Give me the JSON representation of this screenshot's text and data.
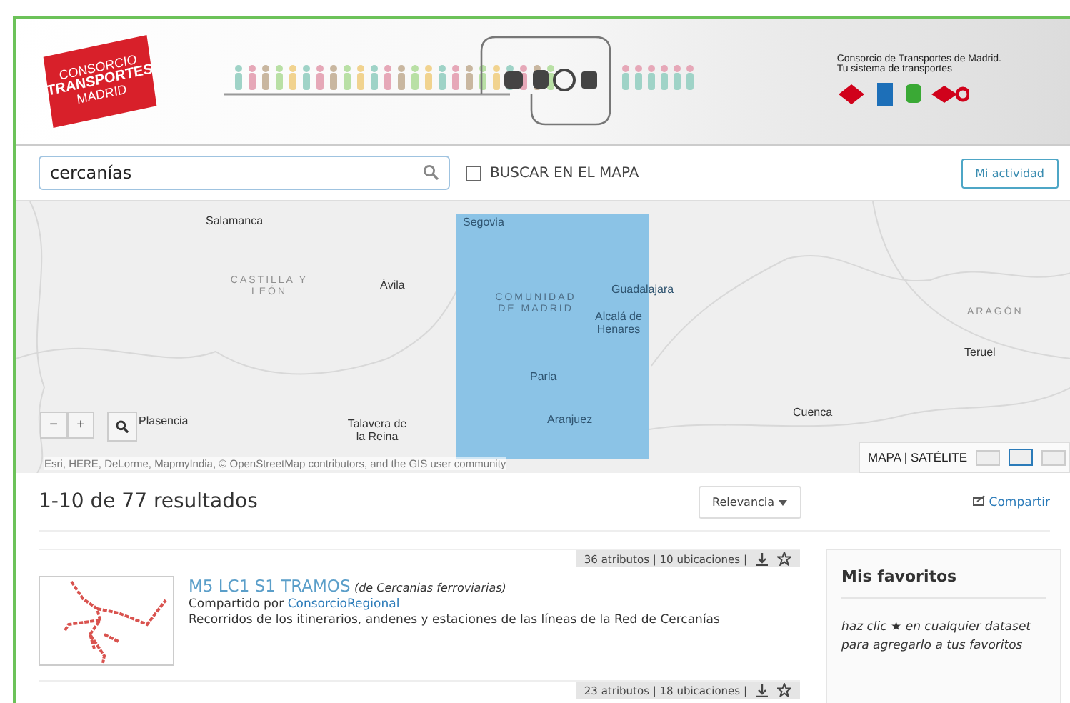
{
  "header": {
    "logo_lines": [
      "CONSORCIO",
      "TRANSPORTES",
      "MADRID"
    ],
    "tagline": [
      "Consorcio de Transportes de Madrid.",
      "Tu sistema de transportes"
    ]
  },
  "search": {
    "value": "cercanías",
    "map_filter": {
      "label": "BUSCAR EN EL MAPA",
      "checked": false
    },
    "activity_button": "Mi actividad"
  },
  "map": {
    "labels": [
      {
        "text": "Salamanca",
        "kind": "city"
      },
      {
        "text": "CASTILLA Y LEÓN",
        "kind": "region"
      },
      {
        "text": "Ávila",
        "kind": "city"
      },
      {
        "text": "Segovia",
        "kind": "city"
      },
      {
        "text": "COMUNIDAD DE MADRID",
        "kind": "region"
      },
      {
        "text": "Guadalajara",
        "kind": "city"
      },
      {
        "text": "Alcalá de Henares",
        "kind": "city"
      },
      {
        "text": "ARAGÓN",
        "kind": "region"
      },
      {
        "text": "Teruel",
        "kind": "city"
      },
      {
        "text": "Parla",
        "kind": "city"
      },
      {
        "text": "Aranjuez",
        "kind": "city"
      },
      {
        "text": "Cuenca",
        "kind": "city"
      },
      {
        "text": "Plasencia",
        "kind": "city"
      },
      {
        "text": "Talavera de la Reina",
        "kind": "city"
      }
    ],
    "zoom_out": "−",
    "zoom_in": "+",
    "attribution": "Esri, HERE, DeLorme, MapmyIndia, © OpenStreetMap contributors, and the GIS user community",
    "basemap_toggle": "MAPA | SATÉLITE"
  },
  "results": {
    "count": "1-10 de 77 resultados",
    "sort": "Relevancia",
    "share": "Compartir",
    "items": [
      {
        "meta": "36 atributos | 10 ubicaciones |",
        "title": "M5 LC1 S1 TRAMOS",
        "source": "(de Cercanias ferroviarias)",
        "shared_by": "Compartido por",
        "owner": "ConsorcioRegional",
        "description": "Recorridos de los itinerarios, andenes y estaciones de las líneas de la Red de Cercanías"
      },
      {
        "meta": "23 atributos | 18 ubicaciones |"
      }
    ]
  },
  "favorites": {
    "title": "Mis favoritos",
    "hint": "haz clic ★ en cualquier dataset para agregarlo a tus favoritos"
  }
}
